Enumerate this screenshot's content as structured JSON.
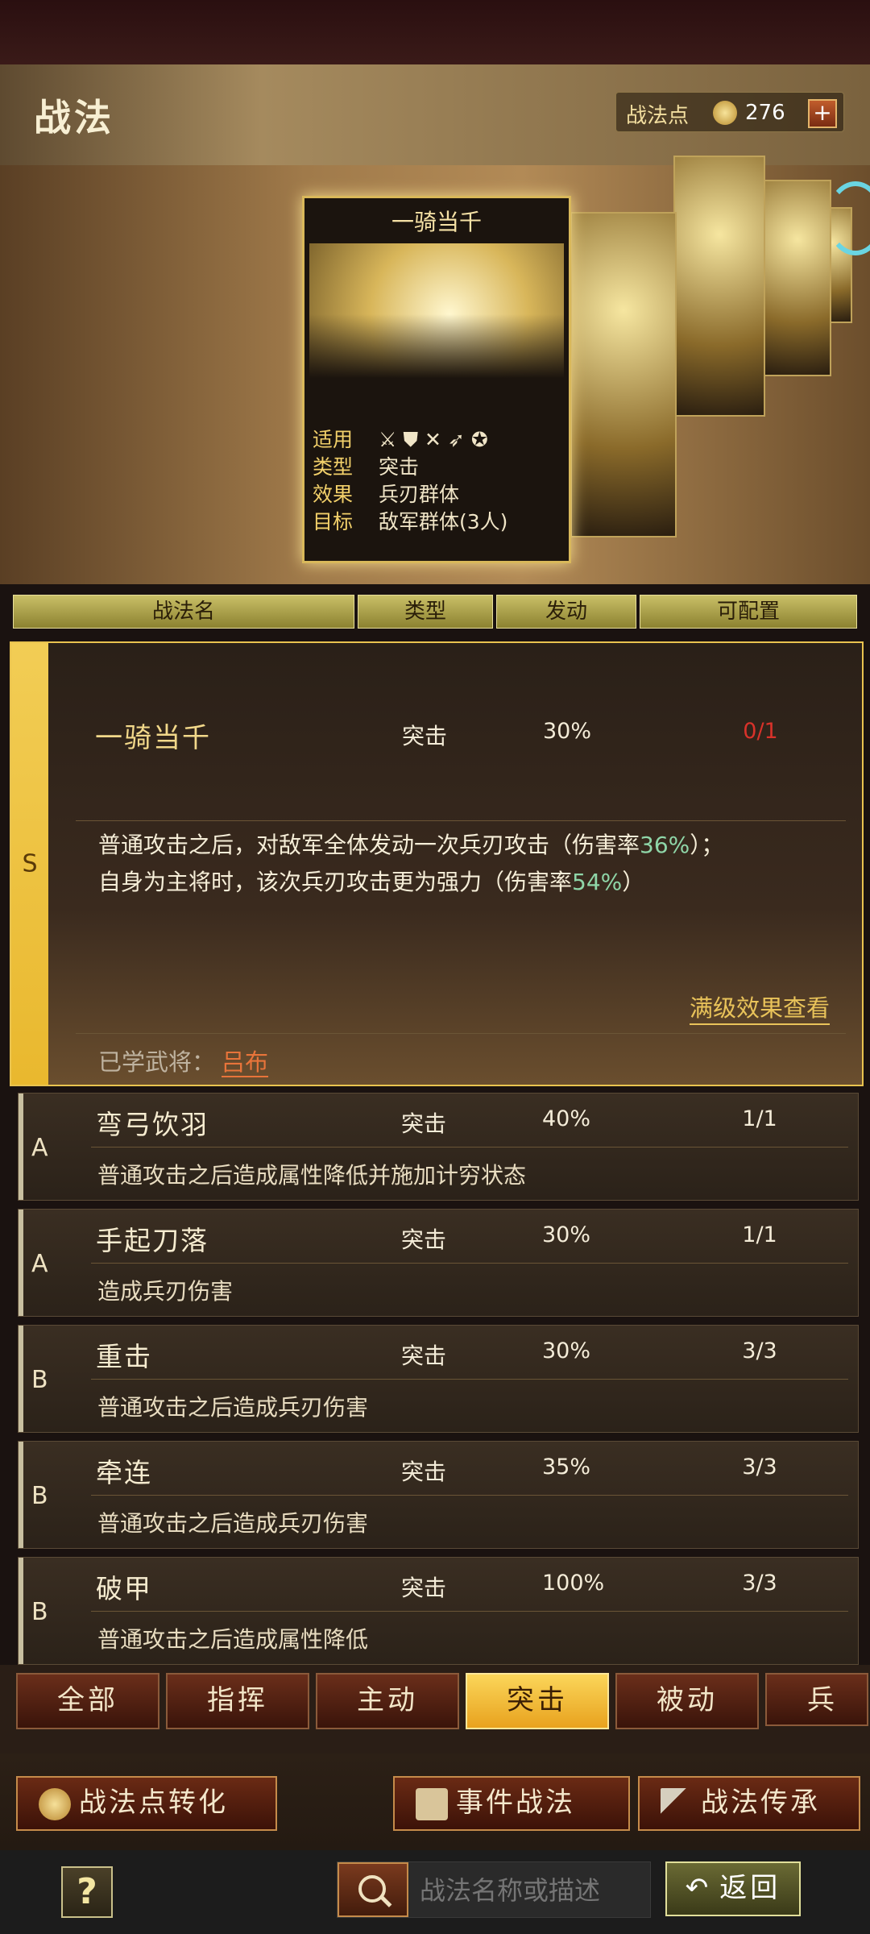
{
  "header": {
    "title": "战法",
    "points_label": "战法点",
    "points_value": "276",
    "plus": "+"
  },
  "featured_card": {
    "name": "一骑当千",
    "info": [
      {
        "key": "适用",
        "value": "⚔ ⛊ ✕ ➶ ✪"
      },
      {
        "key": "类型",
        "value": "突击"
      },
      {
        "key": "效果",
        "value": "兵刃群体"
      },
      {
        "key": "目标",
        "value": "敌军群体(3人)"
      }
    ]
  },
  "table_headers": [
    "战法名",
    "类型",
    "发动",
    "可配置"
  ],
  "selected": {
    "rank": "S",
    "name": "一骑当千",
    "type": "突击",
    "rate": "30%",
    "config": "0/1",
    "desc_line1_a": "普通攻击之后，对敌军全体发动一次兵刃攻击（伤害率",
    "desc_line1_pct": "36%",
    "desc_line1_b": "）；",
    "desc_line2_a": "自身为主将时，该次兵刃攻击更为强力（伤害率",
    "desc_line2_pct": "54%",
    "desc_line2_b": "）",
    "more_link": "满级效果查看",
    "learned_label": "已学武将：",
    "learned_hero": "吕布"
  },
  "rows": [
    {
      "rank": "A",
      "name": "弯弓饮羽",
      "type": "突击",
      "rate": "40%",
      "config": "1/1",
      "desc": "普通攻击之后造成属性降低并施加计穷状态"
    },
    {
      "rank": "A",
      "name": "手起刀落",
      "type": "突击",
      "rate": "30%",
      "config": "1/1",
      "desc": "造成兵刃伤害"
    },
    {
      "rank": "B",
      "name": "重击",
      "type": "突击",
      "rate": "30%",
      "config": "3/3",
      "desc": "普通攻击之后造成兵刃伤害"
    },
    {
      "rank": "B",
      "name": "牵连",
      "type": "突击",
      "rate": "35%",
      "config": "3/3",
      "desc": "普通攻击之后造成兵刃伤害"
    },
    {
      "rank": "B",
      "name": "破甲",
      "type": "突击",
      "rate": "100%",
      "config": "3/3",
      "desc": "普通攻击之后造成属性降低"
    }
  ],
  "tabs": [
    "全部",
    "指挥",
    "主动",
    "突击",
    "被动",
    "兵种"
  ],
  "actions": {
    "convert": "战法点转化",
    "event": "事件战法",
    "inherit": "战法传承"
  },
  "bottom": {
    "help": "?",
    "search_placeholder": "战法名称或描述",
    "back": "返回"
  },
  "colors": {
    "accent_gold": "#e9c34f",
    "active_tab": "#fbd65a",
    "highlight_green": "#8fd6a8",
    "config_red": "#d8322a"
  }
}
